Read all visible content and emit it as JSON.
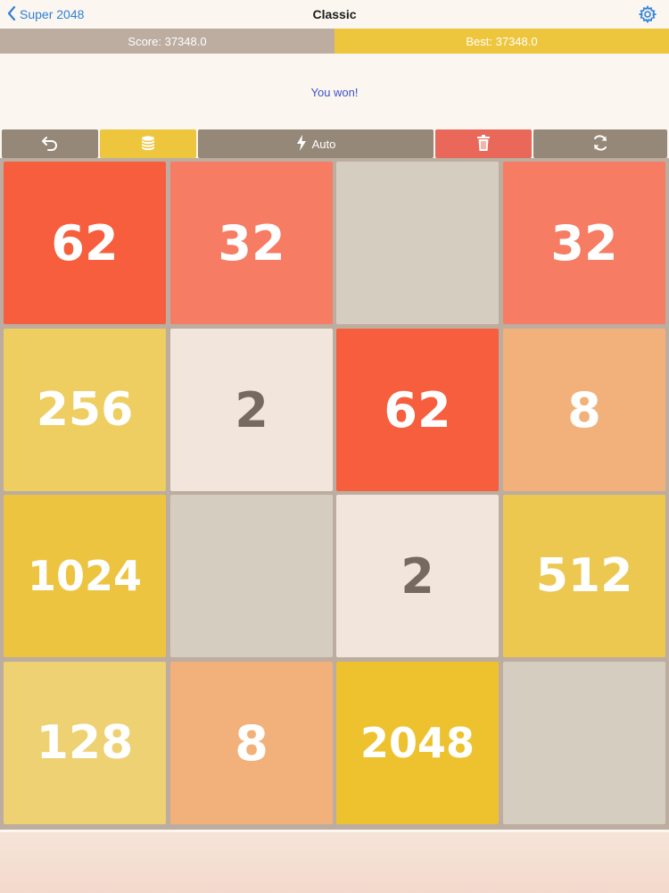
{
  "nav": {
    "back_label": "Super 2048",
    "title": "Classic",
    "accent_color": "#2f80d8",
    "settings_icon": "gear-icon"
  },
  "scores": {
    "score_text": "Score: 37348.0",
    "best_text": "Best: 37348.0"
  },
  "message": "You won!",
  "toolbar": {
    "undo_icon": "undo-icon",
    "coins_icon": "coins-icon",
    "auto_label": "Auto",
    "trash_icon": "trash-icon",
    "restart_icon": "refresh-icon",
    "colors": {
      "undo": "#968878",
      "coins": "#eec63e",
      "auto": "#968878",
      "trash": "#e9685a",
      "restart": "#968878"
    }
  },
  "board": {
    "rows": [
      [
        "62",
        "32",
        "",
        "32"
      ],
      [
        "256",
        "2",
        "62",
        "8"
      ],
      [
        "1024",
        "",
        "2",
        "512"
      ],
      [
        "128",
        "8",
        "2048",
        ""
      ]
    ]
  },
  "tile_colors": {
    "": {
      "bg": "#d6cdc1",
      "fg": "#776e65"
    },
    "2": {
      "bg": "#f1e5dc",
      "fg": "#766a5f"
    },
    "8": {
      "bg": "#f2b17a",
      "fg": "#ffffff"
    },
    "32": {
      "bg": "#f67c63",
      "fg": "#ffffff"
    },
    "62": {
      "bg": "#f75e3d",
      "fg": "#ffffff"
    },
    "128": {
      "bg": "#eed172",
      "fg": "#ffffff"
    },
    "256": {
      "bg": "#eecd61",
      "fg": "#ffffff"
    },
    "512": {
      "bg": "#edc850",
      "fg": "#ffffff"
    },
    "1024": {
      "bg": "#edc43f",
      "fg": "#ffffff"
    },
    "2048": {
      "bg": "#edc22e",
      "fg": "#ffffff"
    }
  }
}
